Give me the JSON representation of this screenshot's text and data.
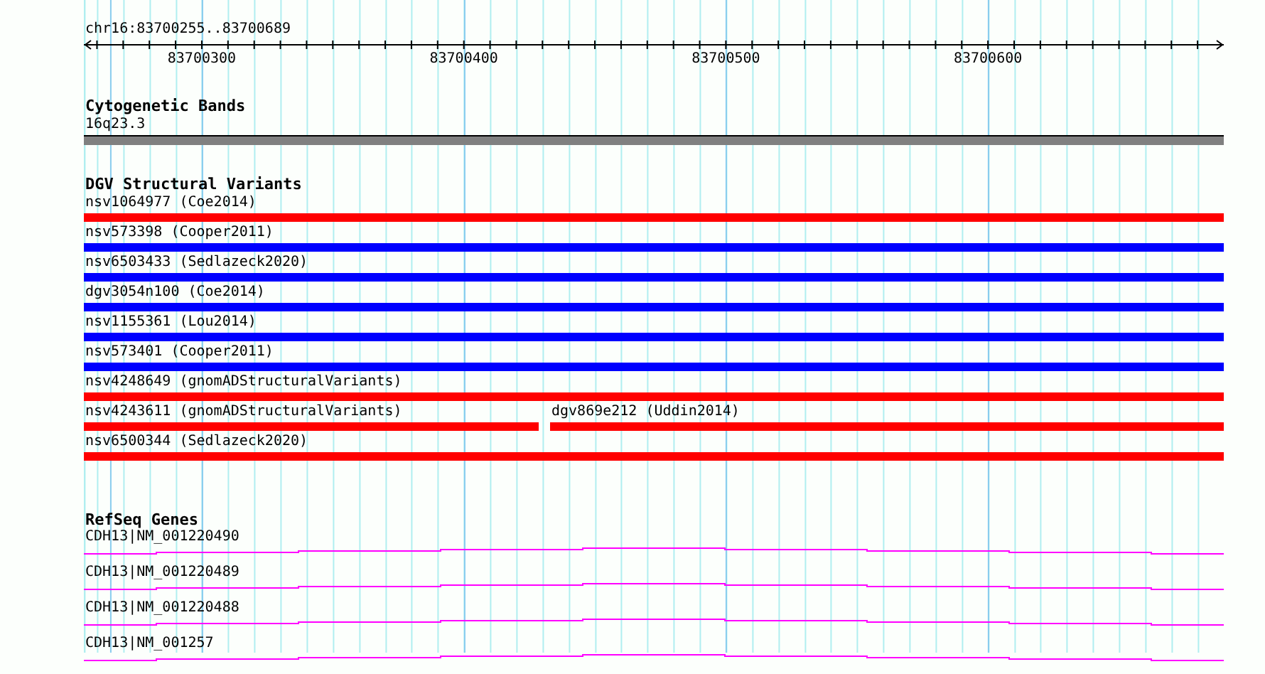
{
  "location": "chr16:83700255..83700689",
  "ruler": {
    "ticks": [
      "83700300",
      "83700400",
      "83700500",
      "83700600"
    ]
  },
  "tracks": [
    {
      "kind": "band",
      "title": "Cytogenetic Bands",
      "label": "16q23.3"
    },
    {
      "kind": "variants",
      "title": "DGV Structural Variants",
      "rows": [
        {
          "features": [
            {
              "label": "nsv1064977 (Coe2014)",
              "color": "#ff0000"
            }
          ]
        },
        {
          "features": [
            {
              "label": "nsv573398 (Cooper2011)",
              "color": "#0000ff"
            }
          ]
        },
        {
          "features": [
            {
              "label": "nsv6503433 (Sedlazeck2020)",
              "color": "#0000ff"
            }
          ]
        },
        {
          "features": [
            {
              "label": "dgv3054n100 (Coe2014)",
              "color": "#0000ff"
            }
          ]
        },
        {
          "features": [
            {
              "label": "nsv1155361 (Lou2014)",
              "color": "#0000ff"
            }
          ]
        },
        {
          "features": [
            {
              "label": "nsv573401 (Cooper2011)",
              "color": "#0000ff"
            }
          ]
        },
        {
          "features": [
            {
              "label": "nsv4248649 (gnomADStructuralVariants)",
              "color": "#ff0000"
            }
          ]
        },
        {
          "features": [
            {
              "label": "nsv4243611 (gnomADStructuralVariants)",
              "color": "#ff0000"
            },
            {
              "label": "dgv869e212 (Uddin2014)",
              "color": "#ff0000"
            }
          ]
        },
        {
          "features": [
            {
              "label": "nsv6500344 (Sedlazeck2020)",
              "color": "#ff0000"
            }
          ]
        }
      ]
    },
    {
      "kind": "genes",
      "title": "RefSeq Genes",
      "genes": [
        {
          "label": "CDH13|NM_001220490"
        },
        {
          "label": "CDH13|NM_001220489"
        },
        {
          "label": "CDH13|NM_001220488"
        },
        {
          "label": "CDH13|NM_001257"
        }
      ]
    }
  ]
}
